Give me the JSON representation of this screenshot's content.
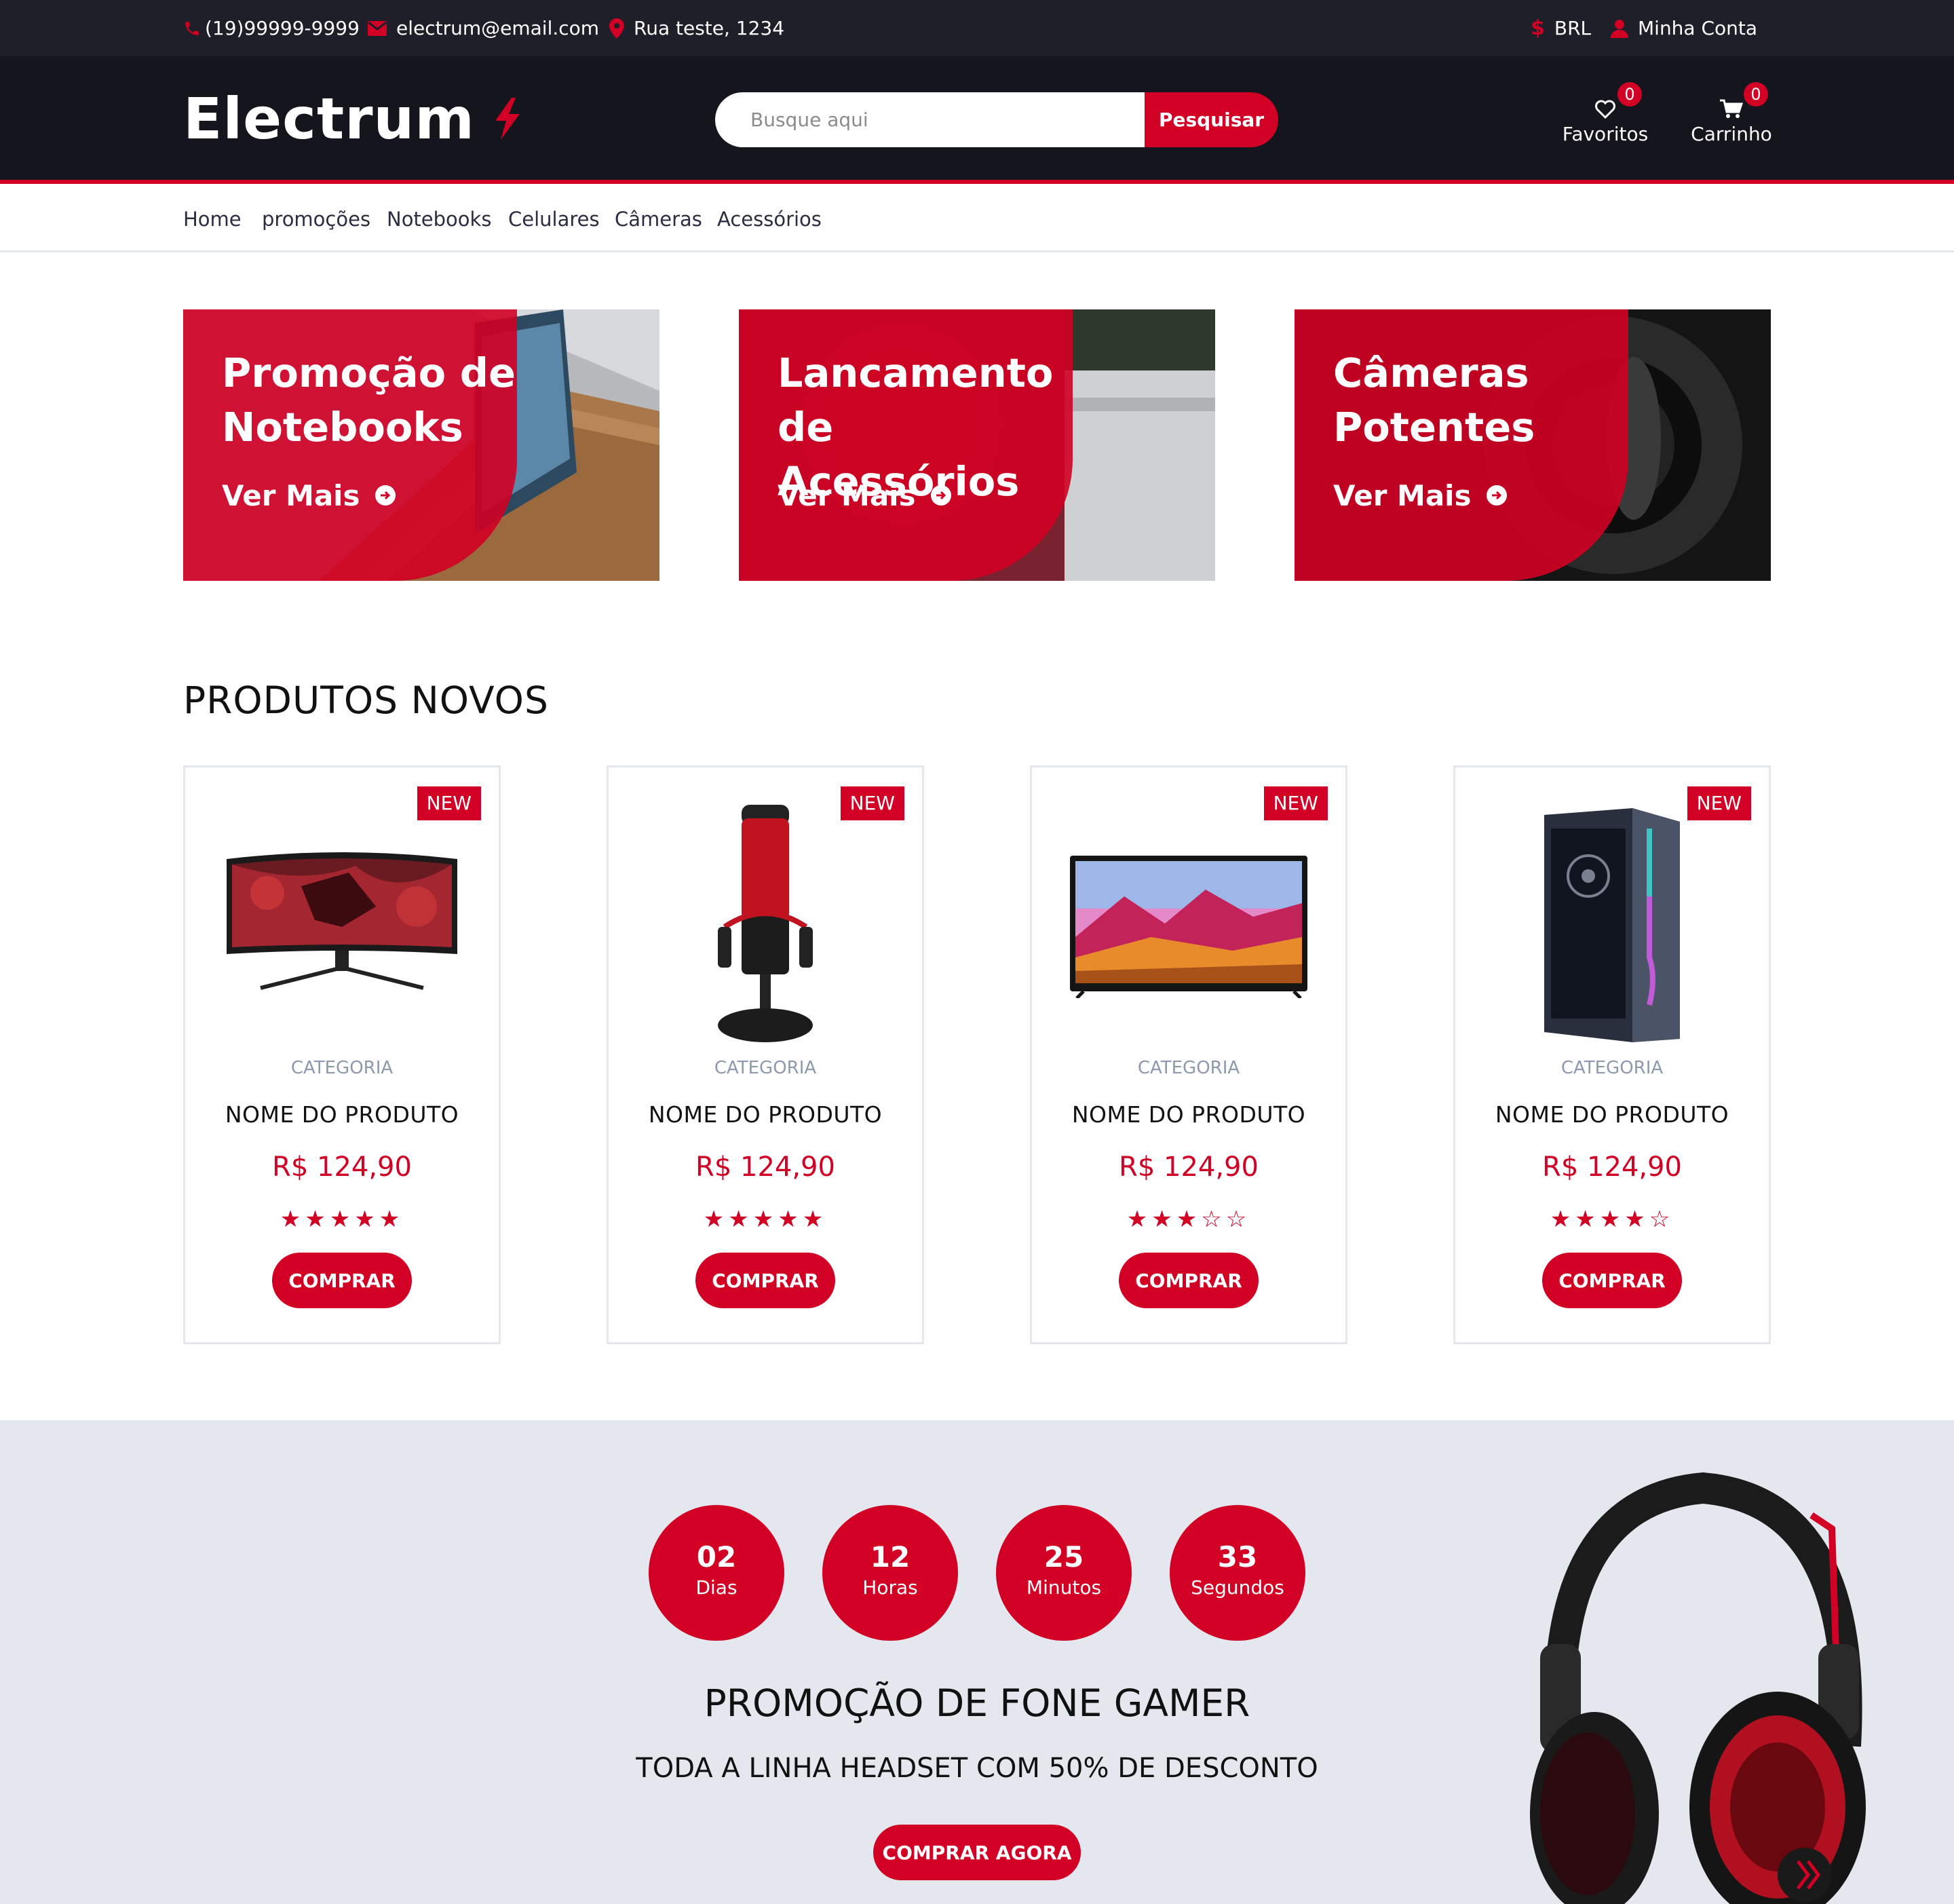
{
  "topbar": {
    "phone": "(19)99999-9999",
    "email": "electrum@email.com",
    "address": "Rua teste, 1234",
    "currency": "BRL",
    "account": "Minha Conta"
  },
  "header": {
    "logo": "Electrum",
    "search_placeholder": "Busque aqui",
    "search_button": "Pesquisar",
    "favorites_label": "Favoritos",
    "favorites_count": "0",
    "cart_label": "Carrinho",
    "cart_count": "0"
  },
  "nav": {
    "items": [
      "Home",
      "promoções",
      "Notebooks",
      "Celulares",
      "Câmeras",
      "Acessórios"
    ]
  },
  "banners": [
    {
      "title": "Promoção de Notebooks",
      "cta": "Ver Mais"
    },
    {
      "title": "Lancamento de Acessórios",
      "cta": "Ver Mais"
    },
    {
      "title": "Câmeras Potentes",
      "cta": "Ver Mais"
    }
  ],
  "products_section": {
    "title": "PRODUTOS NOVOS",
    "items": [
      {
        "badge": "NEW",
        "category": "CATEGORIA",
        "name": "NOME DO PRODUTO",
        "price": "R$ 124,90",
        "rating": 5,
        "button": "COMPRAR",
        "image": "monitor"
      },
      {
        "badge": "NEW",
        "category": "CATEGORIA",
        "name": "NOME DO PRODUTO",
        "price": "R$ 124,90",
        "rating": 5,
        "button": "COMPRAR",
        "image": "microphone"
      },
      {
        "badge": "NEW",
        "category": "CATEGORIA",
        "name": "NOME DO PRODUTO",
        "price": "R$ 124,90",
        "rating": 3,
        "button": "COMPRAR",
        "image": "tv"
      },
      {
        "badge": "NEW",
        "category": "CATEGORIA",
        "name": "NOME DO PRODUTO",
        "price": "R$ 124,90",
        "rating": 4,
        "button": "COMPRAR",
        "image": "pc-case"
      }
    ]
  },
  "promo": {
    "countdown": [
      {
        "value": "02",
        "unit": "Dias"
      },
      {
        "value": "12",
        "unit": "Horas"
      },
      {
        "value": "25",
        "unit": "Minutos"
      },
      {
        "value": "33",
        "unit": "Segundos"
      }
    ],
    "title": "PROMOÇÃO DE FONE GAMER",
    "subtitle": "TODA A LINHA HEADSET COM 50% DE DESCONTO",
    "button": "COMPRAR AGORA"
  },
  "colors": {
    "accent": "#d10024",
    "dark": "#15161d",
    "topbar": "#1e1f29",
    "promo_bg": "#e4e7ed"
  }
}
